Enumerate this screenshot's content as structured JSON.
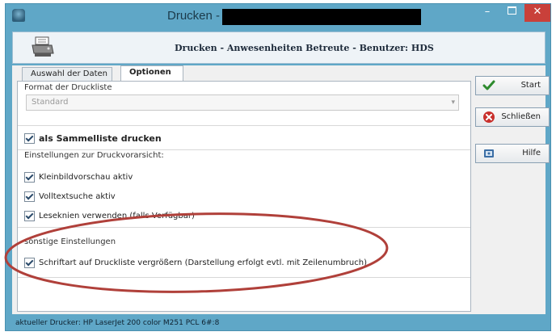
{
  "window": {
    "title": "Drucken -",
    "min_glyph": "–",
    "close_glyph": "✕"
  },
  "header": {
    "title": "Drucken - Anwesenheiten Betreute - Benutzer: HDS",
    "icon": "printer-icon"
  },
  "tabs": [
    {
      "label": "Auswahl der Daten"
    },
    {
      "label": "Optionen"
    }
  ],
  "options": {
    "format_group_label": "Format der Druckliste",
    "format_value": "Standard",
    "sammelliste_label": "als Sammelliste drucken",
    "sammelliste_checked": true,
    "preview_group_label": "Einstellungen zur Druckvorarsicht:",
    "checkboxes": [
      {
        "label": "Kleinbildvorschau aktiv",
        "checked": true
      },
      {
        "label": "Volltextsuche aktiv",
        "checked": true
      },
      {
        "label": "Leseknien verwenden (falls Verfügbar)",
        "checked": true
      }
    ],
    "other_group_label": "sonstige Einstellungen",
    "enlarge_label": "Schriftart auf Druckliste vergrößern (Darstellung erfolgt evtl. mit Zeilenumbruch)",
    "enlarge_checked": true
  },
  "buttons": {
    "start": {
      "label": "Start",
      "icon": "checkmark-icon",
      "color": "#2e8b2e"
    },
    "close": {
      "label": "Schließen",
      "icon": "close-circle-icon",
      "color": "#c9302c"
    },
    "help": {
      "label": "Hilfe",
      "icon": "help-book-icon",
      "color": "#3b6ea5"
    }
  },
  "statusbar": {
    "text": "aktueller Drucker: HP LaserJet 200 color M251 PCL 6#:8"
  },
  "colors": {
    "window_frame": "#5fa7c7",
    "annotation": "#b0403a"
  }
}
